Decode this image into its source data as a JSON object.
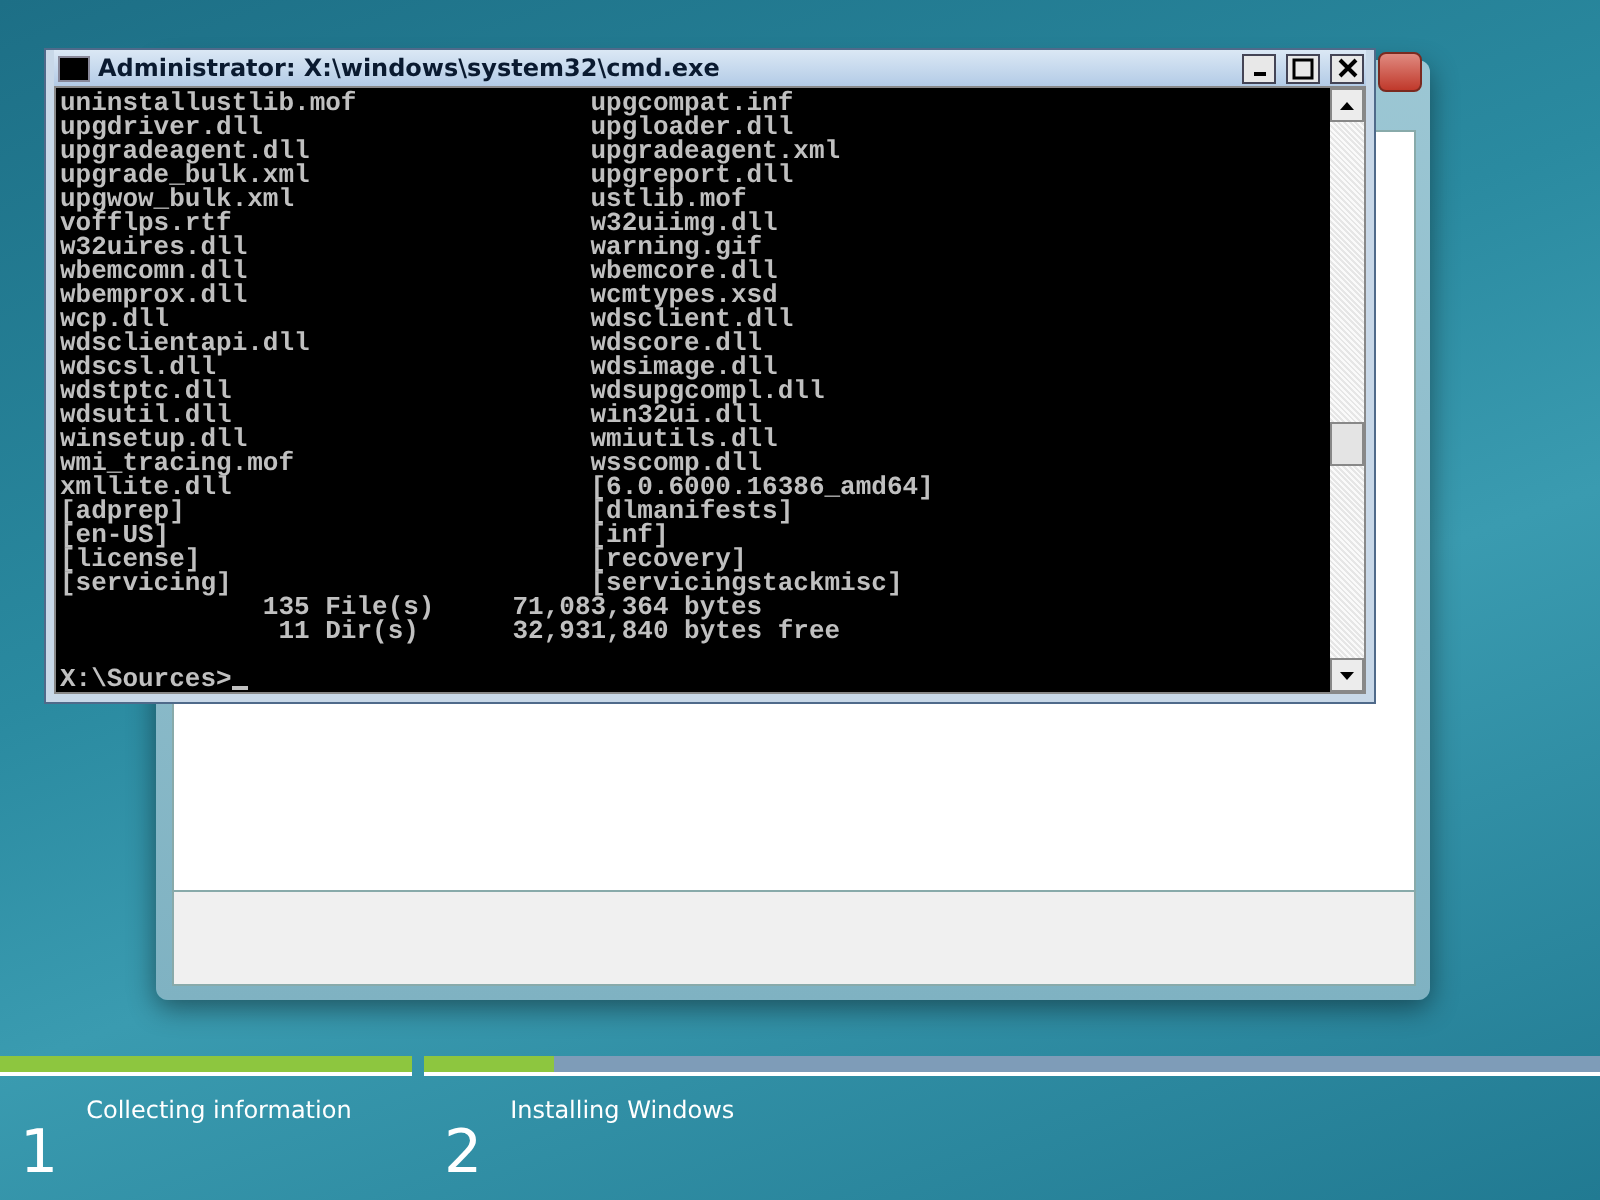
{
  "console_window": {
    "title": "Administrator: X:\\windows\\system32\\cmd.exe",
    "listing": [
      {
        "left": "uninstallustlib.mof",
        "right": "upgcompat.inf"
      },
      {
        "left": "upgdriver.dll",
        "right": "upgloader.dll"
      },
      {
        "left": "upgradeagent.dll",
        "right": "upgradeagent.xml"
      },
      {
        "left": "upgrade_bulk.xml",
        "right": "upgreport.dll"
      },
      {
        "left": "upgwow_bulk.xml",
        "right": "ustlib.mof"
      },
      {
        "left": "vofflps.rtf",
        "right": "w32uiimg.dll"
      },
      {
        "left": "w32uires.dll",
        "right": "warning.gif"
      },
      {
        "left": "wbemcomn.dll",
        "right": "wbemcore.dll"
      },
      {
        "left": "wbemprox.dll",
        "right": "wcmtypes.xsd"
      },
      {
        "left": "wcp.dll",
        "right": "wdsclient.dll"
      },
      {
        "left": "wdsclientapi.dll",
        "right": "wdscore.dll"
      },
      {
        "left": "wdscsl.dll",
        "right": "wdsimage.dll"
      },
      {
        "left": "wdstptc.dll",
        "right": "wdsupgcompl.dll"
      },
      {
        "left": "wdsutil.dll",
        "right": "win32ui.dll"
      },
      {
        "left": "winsetup.dll",
        "right": "wmiutils.dll"
      },
      {
        "left": "wmi_tracing.mof",
        "right": "wsscomp.dll"
      },
      {
        "left": "xmllite.dll",
        "right": "[6.0.6000.16386_amd64]"
      },
      {
        "left": "[adprep]",
        "right": "[dlmanifests]"
      },
      {
        "left": "[en-US]",
        "right": "[inf]"
      },
      {
        "left": "[license]",
        "right": "[recovery]"
      },
      {
        "left": "[servicing]",
        "right": "[servicingstackmisc]"
      }
    ],
    "summary": [
      "             135 File(s)     71,083,364 bytes",
      "              11 Dir(s)      32,931,840 bytes free"
    ],
    "prompt": "X:\\Sources>"
  },
  "setup_progress": {
    "stages": [
      {
        "number": "1",
        "label": "Collecting information",
        "level": 1
      },
      {
        "number": "2",
        "label": "Installing Windows",
        "level": 0.11
      }
    ]
  }
}
